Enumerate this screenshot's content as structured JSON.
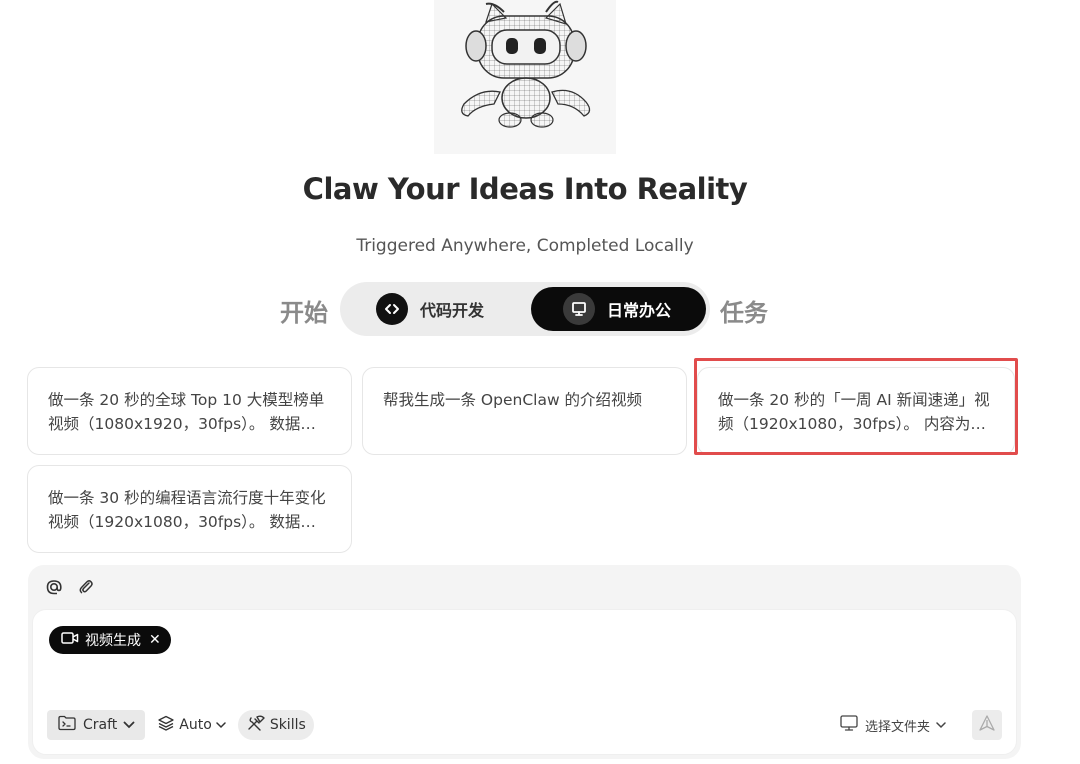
{
  "hero": {
    "title": "Claw Your Ideas Into Reality",
    "subtitle": "Triggered Anywhere, Completed Locally"
  },
  "mode": {
    "prefix": "开始",
    "suffix": "任务",
    "options": [
      {
        "label": "代码开发",
        "icon": "code-icon",
        "selected": false
      },
      {
        "label": "日常办公",
        "icon": "presentation-icon",
        "selected": true
      }
    ]
  },
  "suggestions": [
    {
      "text": "做一条 20 秒的全球 Top 10 大模型榜单视频（1080x1920，30fps）。 数据来…"
    },
    {
      "text": "帮我生成一条 OpenClaw 的介绍视频"
    },
    {
      "text": "做一条 20 秒的「一周 AI 新闻速递」视频（1920x1080，30fps）。 内容为本…"
    },
    {
      "text": "做一条 30 秒的编程语言流行度十年变化视频（1920x1080，30fps）。 数据…"
    }
  ],
  "composer": {
    "tools": [
      "at-icon",
      "paperclip-icon"
    ],
    "chip_label": "视频生成",
    "input_value": "",
    "craft_label": "Craft",
    "auto_label": "Auto",
    "skills_label": "Skills",
    "folder_label": "选择文件夹"
  },
  "colors": {
    "highlight": "#e14c4c",
    "dark": "#0b0b0b"
  }
}
